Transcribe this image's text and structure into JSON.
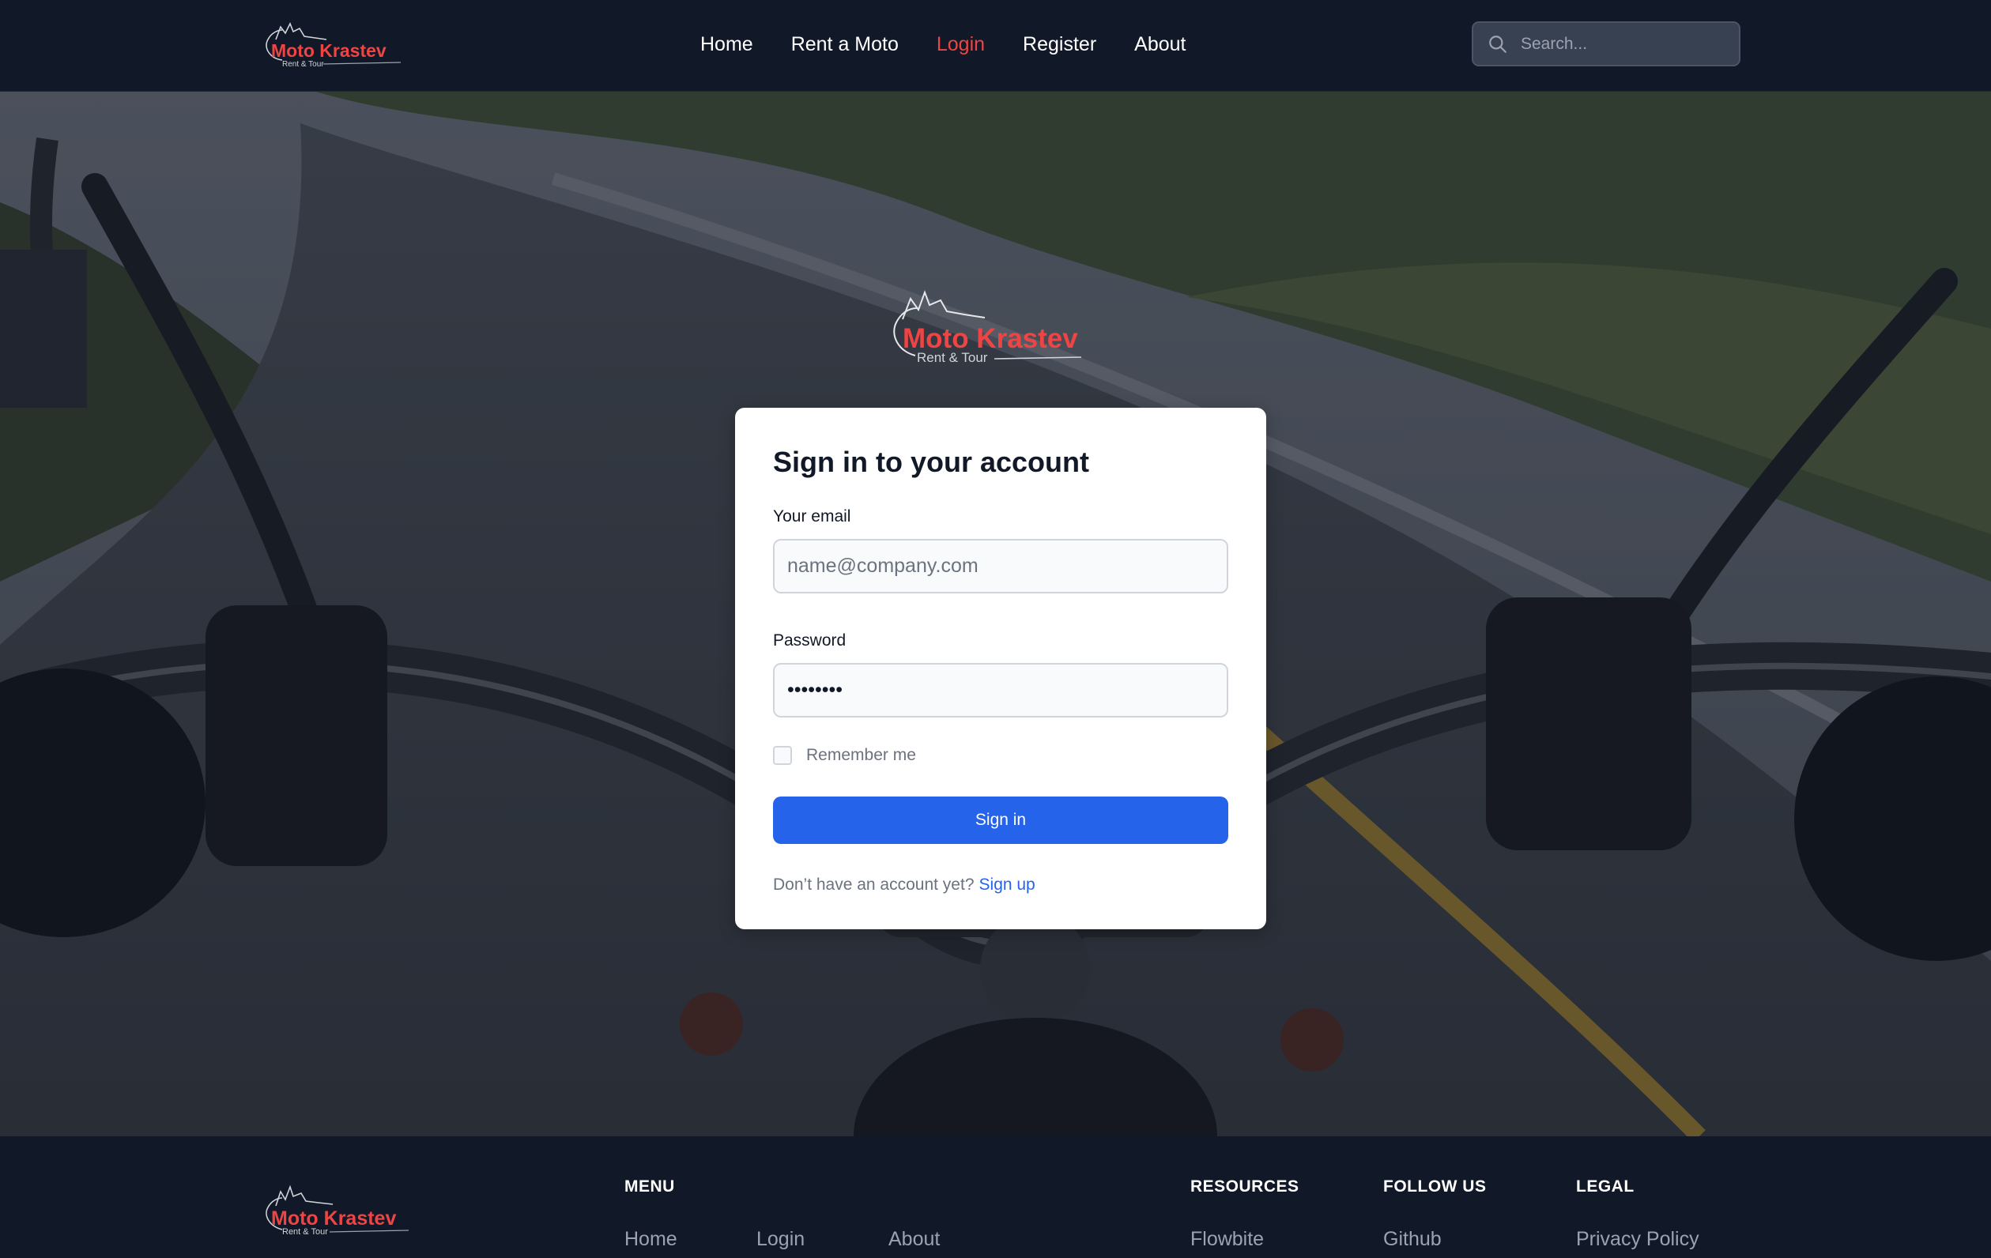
{
  "brand": {
    "name": "Moto Krastev",
    "tagline": "Rent & Tour"
  },
  "nav": {
    "links": [
      {
        "label": "Home",
        "active": false
      },
      {
        "label": "Rent a Moto",
        "active": false
      },
      {
        "label": "Login",
        "active": true
      },
      {
        "label": "Register",
        "active": false
      },
      {
        "label": "About",
        "active": false
      }
    ],
    "search": {
      "placeholder": "Search...",
      "value": ""
    }
  },
  "login": {
    "title": "Sign in to your account",
    "email": {
      "label": "Your email",
      "placeholder": "name@company.com",
      "value": ""
    },
    "password": {
      "label": "Password",
      "value": "••••••••"
    },
    "remember": {
      "label": "Remember me",
      "checked": false
    },
    "submit_label": "Sign in",
    "signup_prompt": "Don’t have an account yet?",
    "signup_link": "Sign up"
  },
  "footer": {
    "menu": {
      "heading": "MENU",
      "links": [
        "Home",
        "Login",
        "About"
      ]
    },
    "resources": {
      "heading": "RESOURCES",
      "links": [
        "Flowbite"
      ]
    },
    "follow": {
      "heading": "FOLLOW US",
      "links": [
        "Github"
      ]
    },
    "legal": {
      "heading": "LEGAL",
      "links": [
        "Privacy Policy"
      ]
    }
  },
  "colors": {
    "nav_bg": "#111827",
    "brand_red": "#ef4444",
    "primary_blue": "#2563eb",
    "card_bg": "#ffffff"
  },
  "icons": {
    "search": "search-icon",
    "logo": "motorcycle-logo"
  }
}
